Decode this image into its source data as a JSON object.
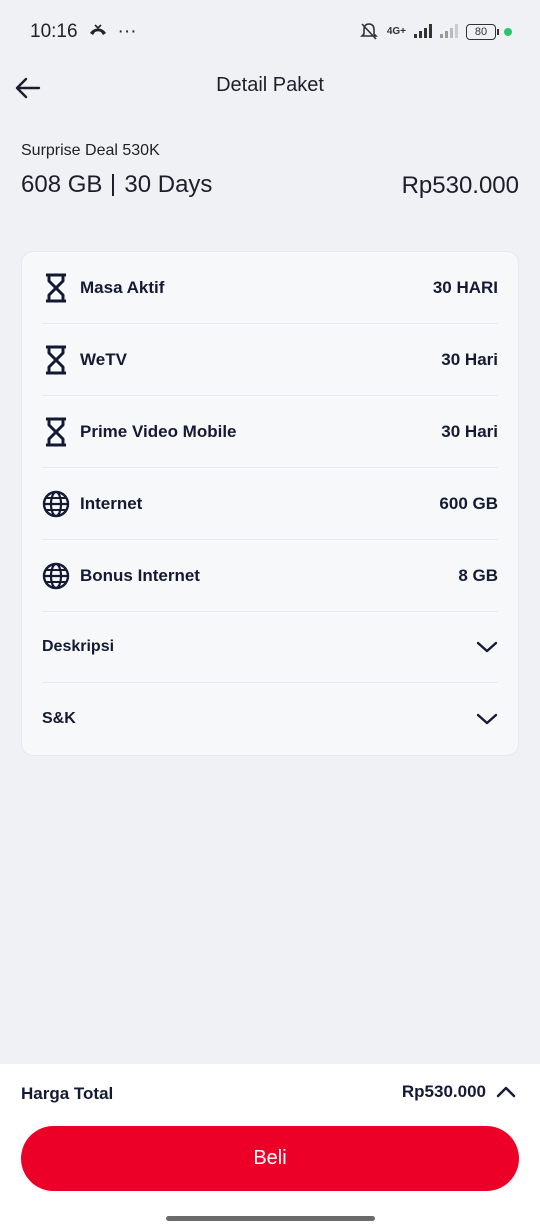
{
  "status_bar": {
    "time": "10:16",
    "more": "···",
    "network": "4G+",
    "battery": "80"
  },
  "header": {
    "title": "Detail Paket"
  },
  "package": {
    "name": "Surprise Deal 530K",
    "quota": "608 GB",
    "duration": "30 Days",
    "price": "Rp530.000"
  },
  "details": [
    {
      "icon": "hourglass-icon",
      "label": "Masa Aktif",
      "value": "30 HARI"
    },
    {
      "icon": "hourglass-icon",
      "label": "WeTV",
      "value": "30 Hari"
    },
    {
      "icon": "hourglass-icon",
      "label": "Prime Video Mobile",
      "value": "30 Hari"
    },
    {
      "icon": "globe-icon",
      "label": "Internet",
      "value": "600 GB"
    },
    {
      "icon": "globe-icon",
      "label": "Bonus Internet",
      "value": "8 GB"
    }
  ],
  "sections": [
    {
      "label": "Deskripsi"
    },
    {
      "label": "S&K"
    }
  ],
  "footer": {
    "total_label": "Harga Total",
    "total_value": "Rp530.000",
    "buy_label": "Beli"
  },
  "colors": {
    "accent": "#ec0028",
    "text_dark": "#141a33",
    "background": "#f0f1f5"
  }
}
